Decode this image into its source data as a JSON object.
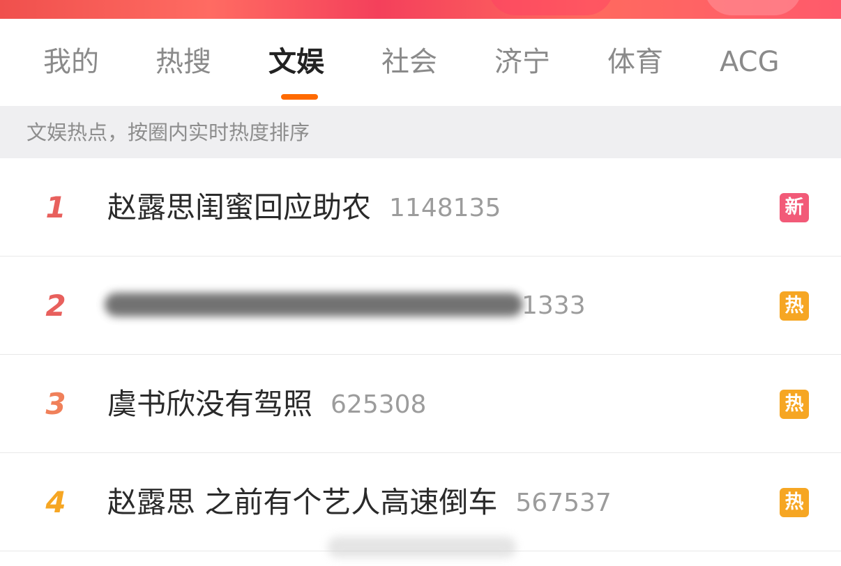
{
  "tabs": [
    {
      "label": "我的",
      "active": false
    },
    {
      "label": "热搜",
      "active": false
    },
    {
      "label": "文娱",
      "active": true
    },
    {
      "label": "社会",
      "active": false
    },
    {
      "label": "济宁",
      "active": false
    },
    {
      "label": "体育",
      "active": false
    },
    {
      "label": "ACG",
      "active": false
    }
  ],
  "hint": "文娱热点，按圈内实时热度排序",
  "rows": [
    {
      "rank": "1",
      "rank_color": "#e8605d",
      "title": "赵露思闺蜜回应助农",
      "count": "1148135",
      "badge": "新",
      "badge_color": "#f25a78"
    },
    {
      "rank": "2",
      "rank_color": "#e8605d",
      "title": "",
      "count": "1333",
      "badge": "热",
      "badge_color": "#f6a623"
    },
    {
      "rank": "3",
      "rank_color": "#f0805a",
      "title": "虞书欣没有驾照",
      "count": "625308",
      "badge": "热",
      "badge_color": "#f6a623"
    },
    {
      "rank": "4",
      "rank_color": "#f6a623",
      "title": "赵露思 之前有个艺人高速倒车",
      "count": "567537",
      "badge": "热",
      "badge_color": "#f6a623"
    }
  ],
  "colors": {
    "accent": "#ff6a00",
    "hint_bg": "#efeff1"
  }
}
